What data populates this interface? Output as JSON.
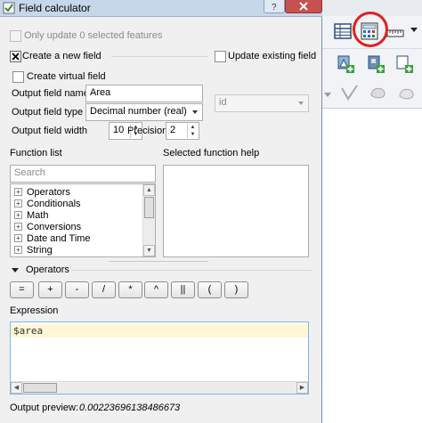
{
  "window": {
    "title": "Field calculator"
  },
  "only_selected": {
    "label": "Only update 0 selected features",
    "checked": false,
    "enabled": false
  },
  "create_new_field": {
    "label": "Create a new field",
    "checked": true
  },
  "update_existing": {
    "label": "Update existing field",
    "checked": false,
    "field_value": "id"
  },
  "create_virtual": {
    "label": "Create virtual field",
    "checked": false
  },
  "output_name": {
    "label": "Output field name",
    "value": "Area"
  },
  "output_type": {
    "label": "Output field type",
    "value": "Decimal number (real)"
  },
  "output_width": {
    "label": "Output field width",
    "value": "10"
  },
  "precision": {
    "label": "Precision",
    "value": "2"
  },
  "function_list": {
    "label": "Function list",
    "search_placeholder": "Search",
    "items": [
      "Operators",
      "Conditionals",
      "Math",
      "Conversions",
      "Date and Time",
      "String"
    ]
  },
  "selected_help": {
    "label": "Selected function help"
  },
  "operators": {
    "label": "Operators",
    "buttons": [
      "=",
      "+",
      "-",
      "/",
      "*",
      "^",
      "||",
      "(",
      ")"
    ]
  },
  "expression": {
    "label": "Expression",
    "value": "$area"
  },
  "output_preview": {
    "label": "Output preview:",
    "value": "0.00223696138486673"
  },
  "icons": {
    "title": "field-calculator-icon",
    "toolbar_highlight": "field-calculator-toolbar-icon"
  },
  "colors": {
    "highlight_ring": "#e02020",
    "title_bar": "#c7d7ea"
  }
}
